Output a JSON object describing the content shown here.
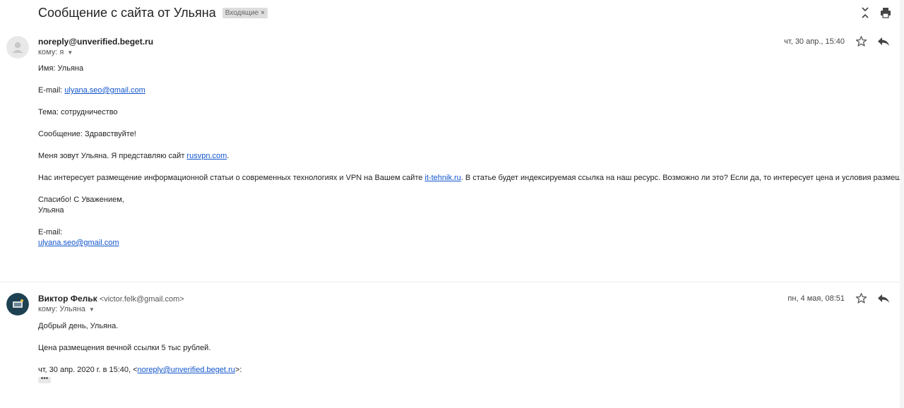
{
  "thread": {
    "subject": "Сообщение с сайта от Ульяна",
    "label": "Входящие",
    "label_remove": "×"
  },
  "toolbar": {
    "icons": [
      "collapse-icon",
      "print-icon",
      "open-new-window-icon"
    ]
  },
  "messages": [
    {
      "sender_name": "noreply@unverified.beget.ru",
      "sender_email": "",
      "to_line": "кому: я",
      "date": "чт, 30 апр., 15:40",
      "avatar": "default-avatar",
      "body": {
        "name_line": "Имя: Ульяна",
        "email_label": "E-mail: ",
        "email_link": "ulyana.seo@gmail.com",
        "topic_line": "Тема: сотрудничество",
        "message_line": "Сообщение: Здравствуйте!",
        "intro_text": "Меня зовут Ульяна. Я представляю сайт ",
        "intro_link": "rusvpn.com",
        "intro_end": ".",
        "request_text": "Нас интересует размещение информационной статьи о современных технологиях и VPN на Вашем сайте ",
        "request_link": "it-tehnik.ru",
        "request_end": ". В статье будет индексируемая ссылка на наш ресурс. Возможно ли это? Если да, то интересует цена и условия размещения статьи.",
        "thanks_line": "Спасибо! С Уважением,",
        "sign_name": "Ульяна",
        "sign_email_label": "E-mail:",
        "sign_email_link": "ulyana.seo@gmail.com"
      }
    },
    {
      "sender_name": "Виктор Фельк",
      "sender_email": "<victor.felk@gmail.com>",
      "to_line": "кому: Ульяна",
      "date": "пн, 4 мая, 08:51",
      "avatar": "photo-avatar",
      "body": {
        "greeting": "Добрый день, Ульяна.",
        "price_line": "Цена размещения вечной ссылки 5 тыс рублей.",
        "quote_text": "чт, 30 апр. 2020 г. в 15:40, <",
        "quote_link": "noreply@unverified.beget.ru",
        "quote_end": ">:",
        "show_trimmed": "•••"
      }
    }
  ],
  "colors": {
    "link": "#1155cc",
    "label_bg": "#dddddd",
    "text": "#222222"
  }
}
